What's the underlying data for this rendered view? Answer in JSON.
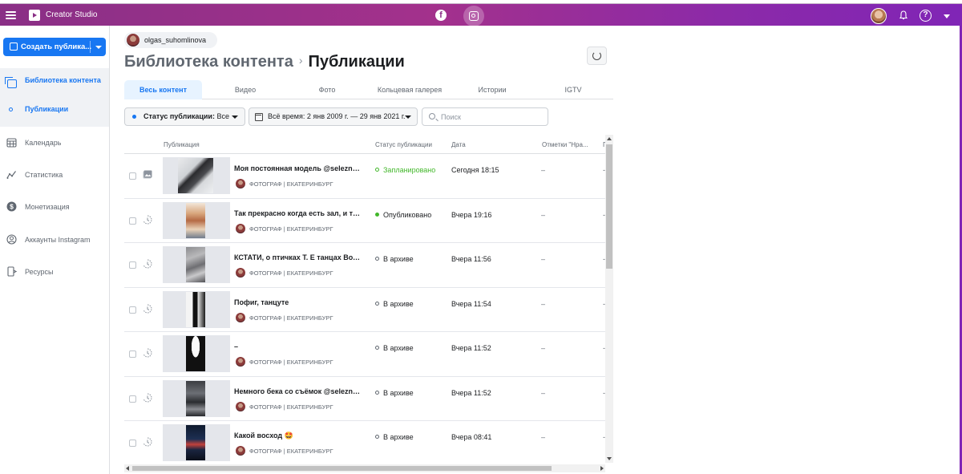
{
  "app": {
    "title": "Creator Studio",
    "accent_color": "#1877f2",
    "topbar_color": "#a3318c"
  },
  "topbar": {
    "platforms": [
      "facebook-icon",
      "instagram-icon"
    ],
    "active_platform": "instagram-icon"
  },
  "sidebar": {
    "create_label": "Создать публика...",
    "library": {
      "label": "Библиотека контента",
      "sub_label": "Публикации"
    },
    "items": [
      {
        "label": "Календарь",
        "icon": "calendar-icon"
      },
      {
        "label": "Статистика",
        "icon": "stats-icon"
      },
      {
        "label": "Монетизация",
        "icon": "dollar-icon"
      },
      {
        "label": "Аккаунты Instagram",
        "icon": "instagram-accounts-icon"
      },
      {
        "label": "Ресурсы",
        "icon": "resources-icon"
      }
    ]
  },
  "account": {
    "username": "olgas_suhomlinova"
  },
  "breadcrumb": {
    "root": "Библиотека контента",
    "separator": "›",
    "current": "Публикации"
  },
  "tabs": [
    {
      "label": "Весь контент",
      "active": true
    },
    {
      "label": "Видео",
      "active": false
    },
    {
      "label": "Фото",
      "active": false
    },
    {
      "label": "Кольцевая галерея",
      "active": false
    },
    {
      "label": "Истории",
      "active": false
    },
    {
      "label": "IGTV",
      "active": false
    }
  ],
  "filters": {
    "status_label": "Статус публикации:",
    "status_value": "Все",
    "date_value": "Всё время: 2 янв 2009 г. — 29 янв 2021 г.",
    "search_placeholder": "Поиск"
  },
  "table": {
    "columns": [
      "Публикация",
      "Статус публикации",
      "Дата",
      "Отметки \"Нра...",
      "Г"
    ],
    "rows": [
      {
        "title": "Моя постоянная модель @selezne...",
        "account": "ФОТОГРАФ | ЕКАТЕРИНБУРГ",
        "status": "Запланировано",
        "status_color": "#42b72a",
        "status_dot": "ring",
        "status_text_color": "#42b72a",
        "date": "Сегодня 18:15",
        "likes": "–",
        "extra": "-",
        "type_icon": "photo-icon"
      },
      {
        "title": "Так прекрасно когда есть зал, и та...",
        "account": "ФОТОГРАФ | ЕКАТЕРИНБУРГ",
        "status": "Опубликовано",
        "status_color": "#42b72a",
        "status_dot": "solid",
        "status_text_color": "#1c1e21",
        "date": "Вчера 19:16",
        "likes": "–",
        "extra": "-",
        "type_icon": "story-icon"
      },
      {
        "title": "КСТАТИ, о птичках Т. Е танцах Вот...",
        "account": "ФОТОГРАФ | ЕКАТЕРИНБУРГ",
        "status": "В архиве",
        "status_color": "#606770",
        "status_dot": "ring",
        "status_text_color": "#1c1e21",
        "date": "Вчера 11:56",
        "likes": "–",
        "extra": "-",
        "type_icon": "story-icon"
      },
      {
        "title": "Пофиг, танцуте",
        "account": "ФОТОГРАФ | ЕКАТЕРИНБУРГ",
        "status": "В архиве",
        "status_color": "#606770",
        "status_dot": "ring",
        "status_text_color": "#1c1e21",
        "date": "Вчера 11:54",
        "likes": "–",
        "extra": "-",
        "type_icon": "story-icon"
      },
      {
        "title": "–",
        "account": "ФОТОГРАФ | ЕКАТЕРИНБУРГ",
        "status": "В архиве",
        "status_color": "#606770",
        "status_dot": "ring",
        "status_text_color": "#1c1e21",
        "date": "Вчера 11:52",
        "likes": "–",
        "extra": "-",
        "type_icon": "story-icon"
      },
      {
        "title": "Немного бека со съёмок @selezne...",
        "account": "ФОТОГРАФ | ЕКАТЕРИНБУРГ",
        "status": "В архиве",
        "status_color": "#606770",
        "status_dot": "ring",
        "status_text_color": "#1c1e21",
        "date": "Вчера 11:52",
        "likes": "–",
        "extra": "-",
        "type_icon": "story-icon"
      },
      {
        "title": "Какой восход 🤩",
        "account": "ФОТОГРАФ | ЕКАТЕРИНБУРГ",
        "status": "В архиве",
        "status_color": "#606770",
        "status_dot": "ring",
        "status_text_color": "#1c1e21",
        "date": "Вчера 08:41",
        "likes": "–",
        "extra": "-",
        "type_icon": "story-icon"
      }
    ]
  }
}
